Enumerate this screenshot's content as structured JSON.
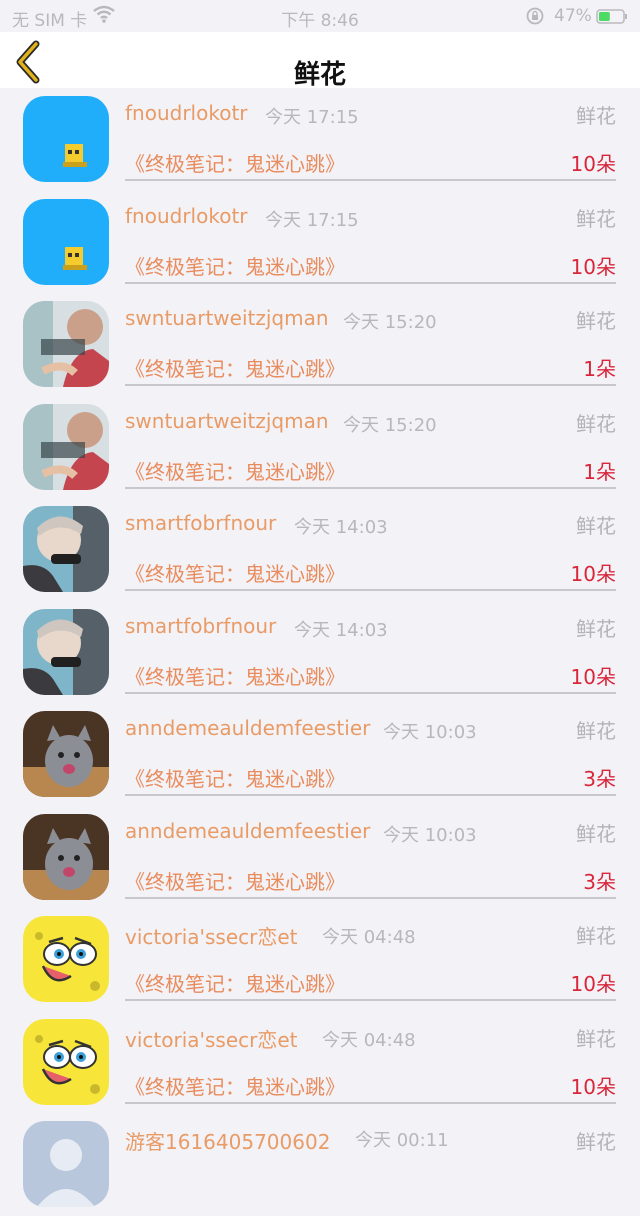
{
  "status_bar": {
    "carrier": "无 SIM 卡",
    "time": "下午 8:46",
    "battery_percent": "47%",
    "battery_level": 0.47,
    "wifi_icon": "wifi-icon",
    "lock_icon": "rotation-lock-icon"
  },
  "nav": {
    "title": "鲜花",
    "back_icon": "chevron-left-icon",
    "back_color": "#e0b21b"
  },
  "colors": {
    "username": "#e99b66",
    "book": "#e98c5d",
    "count": "#d9263a",
    "meta": "#b8b8bb"
  },
  "rows": [
    {
      "username": "fnoudrlokotr",
      "time": "今天 17:15",
      "gift": "鲜花",
      "book": "《终极笔记：鬼迷心跳》",
      "count": "10朵",
      "avatar": "blue-cartoon-avatar"
    },
    {
      "username": "fnoudrlokotr",
      "time": "今天 17:15",
      "gift": "鲜花",
      "book": "《终极笔记：鬼迷心跳》",
      "count": "10朵",
      "avatar": "blue-cartoon-avatar"
    },
    {
      "username": "swntuartweitzjqman",
      "time": "今天 15:20",
      "gift": "鲜花",
      "book": "《终极笔记：鬼迷心跳》",
      "count": "1朵",
      "avatar": "girl-photo-avatar"
    },
    {
      "username": "swntuartweitzjqman",
      "time": "今天 15:20",
      "gift": "鲜花",
      "book": "《终极笔记：鬼迷心跳》",
      "count": "1朵",
      "avatar": "girl-photo-avatar"
    },
    {
      "username": "smartfobrfnour",
      "time": "今天 14:03",
      "gift": "鲜花",
      "book": "《终极笔记：鬼迷心跳》",
      "count": "10朵",
      "avatar": "boy-photo-avatar"
    },
    {
      "username": "smartfobrfnour",
      "time": "今天 14:03",
      "gift": "鲜花",
      "book": "《终极笔记：鬼迷心跳》",
      "count": "10朵",
      "avatar": "boy-photo-avatar"
    },
    {
      "username": "anndemeauldemfeestier",
      "time": "今天 10:03",
      "gift": "鲜花",
      "book": "《终极笔记：鬼迷心跳》",
      "count": "3朵",
      "avatar": "cat-photo-avatar"
    },
    {
      "username": "anndemeauldemfeestier",
      "time": "今天 10:03",
      "gift": "鲜花",
      "book": "《终极笔记：鬼迷心跳》",
      "count": "3朵",
      "avatar": "cat-photo-avatar"
    },
    {
      "username": "victoria'ssecr恋et",
      "time": "今天 04:48",
      "gift": "鲜花",
      "book": "《终极笔记：鬼迷心跳》",
      "count": "10朵",
      "avatar": "spongebob-avatar"
    },
    {
      "username": "victoria'ssecr恋et",
      "time": "今天 04:48",
      "gift": "鲜花",
      "book": "《终极笔记：鬼迷心跳》",
      "count": "10朵",
      "avatar": "spongebob-avatar"
    }
  ],
  "partial_row": {
    "username": "游客1616405700602",
    "time": "今天 00:11",
    "gift": "鲜花",
    "avatar": "default-avatar"
  }
}
